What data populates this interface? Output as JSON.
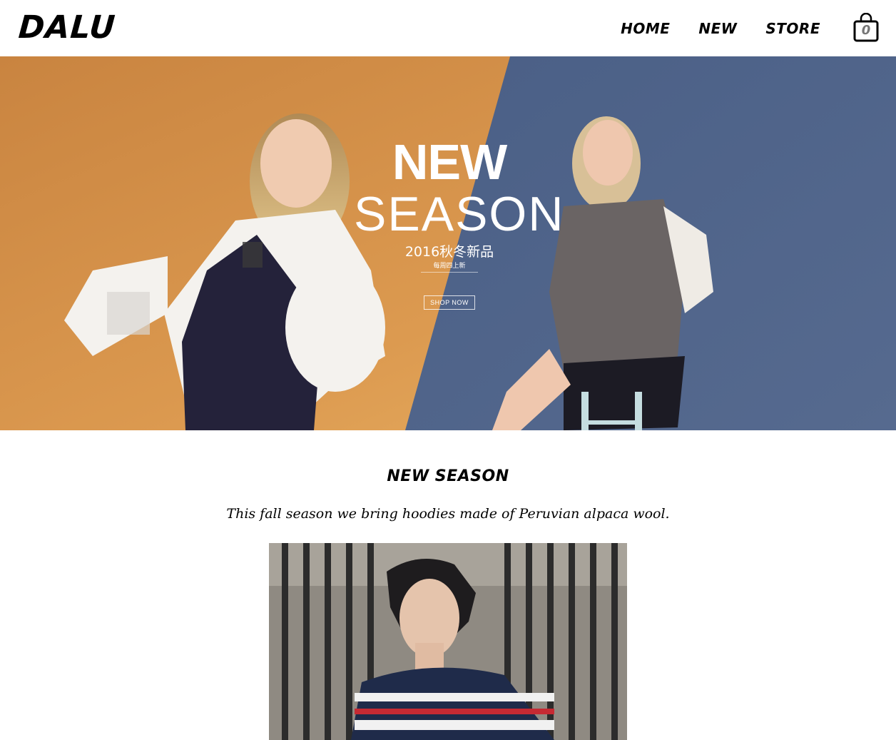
{
  "header": {
    "logo": "DALU",
    "nav": [
      {
        "label": "HOME"
      },
      {
        "label": "NEW"
      },
      {
        "label": "STORE"
      }
    ],
    "cart_count": "0"
  },
  "hero": {
    "headline_top": "NEW",
    "headline_bottom": "SEASON",
    "subtitle": "2016秋冬新品",
    "subtitle_small": "每周四上新",
    "cta_label": "SHOP NOW",
    "colors": {
      "left": "#d48e46",
      "right": "#4f6488"
    }
  },
  "section": {
    "title": "NEW SEASON",
    "description": "This fall season we bring hoodies made of Peruvian alpaca wool."
  }
}
